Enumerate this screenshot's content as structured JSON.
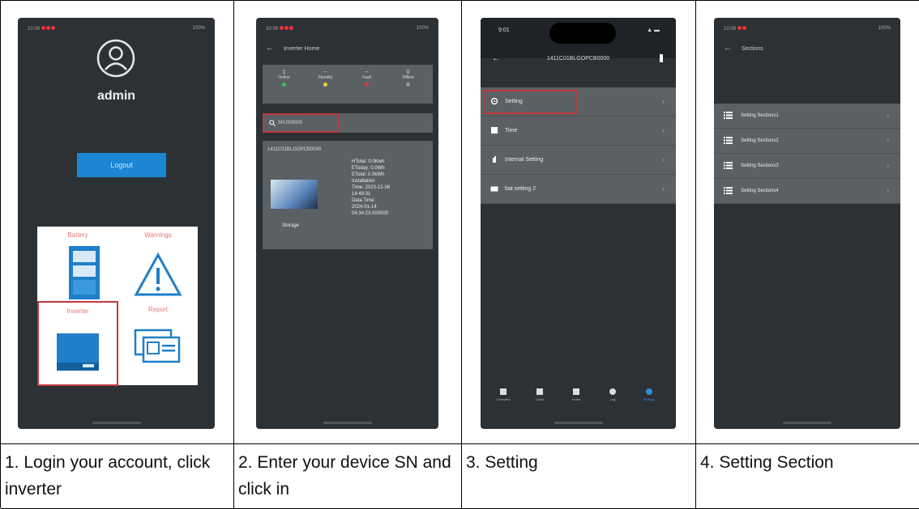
{
  "steps": [
    {
      "caption": "1. Login your account, click inverter",
      "status": {
        "time": "10:09",
        "battery": "100%"
      },
      "username": "admin",
      "logout_label": "Logout",
      "tiles": [
        {
          "label": "Battery",
          "icon": "battery-icon"
        },
        {
          "label": "Warnings",
          "icon": "warning-icon"
        },
        {
          "label": "Inverter",
          "icon": "inverter-icon",
          "highlighted": true
        },
        {
          "label": "Report",
          "icon": "report-icon"
        }
      ]
    },
    {
      "caption": "2. Enter your device SN and click in",
      "status": {
        "time": "10:09",
        "battery": "100%"
      },
      "header_title": "Inverter Home",
      "stats": [
        {
          "label": "Online",
          "count": "1",
          "color": "#3fbf4a"
        },
        {
          "label": "Standby",
          "count": "--",
          "color": "#e8d23a"
        },
        {
          "label": "Fault",
          "count": "--",
          "color": "#d93b3b"
        },
        {
          "label": "Offline",
          "count": "0",
          "color": "#9a9a9a"
        }
      ],
      "search_placeholder": "SN:000000",
      "device": {
        "sn": "1411C01BLGOPCB0000",
        "type": "Storage",
        "info": "HTotal: 0.0Kwh\nEToday: 0.0Wh\nETotal: 0.0kWh\nInstallation\nTime: 2023-12-08\n14:49:31\nData Time:\n2024-01-14\n04:34:23.000000"
      }
    },
    {
      "caption": "3. Setting",
      "status": {
        "time": "9:01"
      },
      "header_sn": "1411C01BLGOPCB0000",
      "menu": [
        {
          "label": "Setting",
          "icon": "gear-icon",
          "highlighted": true
        },
        {
          "label": "Time",
          "icon": "clock-icon"
        },
        {
          "label": "Internal Setting",
          "icon": "hand-icon"
        },
        {
          "label": "bat setting 2",
          "icon": "battery-icon"
        }
      ],
      "tabs": [
        "Overview",
        "Chart",
        "Home",
        "Log",
        "Settings"
      ],
      "colors": {
        "active_tab": "#2a8fd7",
        "highlight": "#c0393b"
      }
    },
    {
      "caption": "4. Setting Section",
      "status": {
        "time": "10:09",
        "battery": "100%"
      },
      "header_title": "Sections",
      "sections": [
        "Setting Sections1",
        "Setting Sections2",
        "Setting Sections3",
        "Setting Sections4"
      ]
    }
  ]
}
